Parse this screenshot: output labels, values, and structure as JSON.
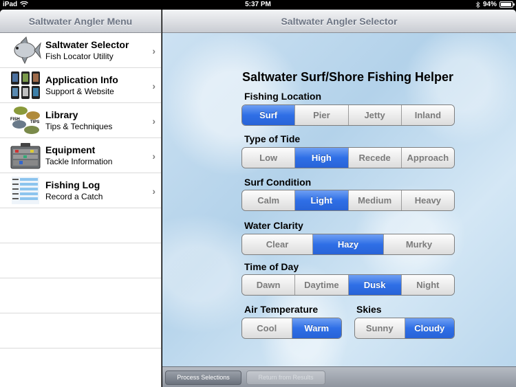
{
  "status": {
    "device": "iPad",
    "time": "5:37 PM",
    "battery": "94%",
    "battery_level": 0.94
  },
  "sidebar": {
    "title": "Saltwater Angler Menu",
    "items": [
      {
        "title": "Saltwater Selector",
        "subtitle": "Fish Locator Utility",
        "icon": "fish-icon"
      },
      {
        "title": "Application Info",
        "subtitle": "Support & Website",
        "icon": "phones-icon"
      },
      {
        "title": "Library",
        "subtitle": "Tips & Techniques",
        "icon": "fish-library-icon",
        "thumb_text": [
          "FISH",
          "TIPS"
        ]
      },
      {
        "title": "Equipment",
        "subtitle": "Tackle Information",
        "icon": "tackle-box-icon"
      },
      {
        "title": "Fishing Log",
        "subtitle": "Record a Catch",
        "icon": "log-list-icon"
      }
    ]
  },
  "main": {
    "title": "Saltwater Angler Selector",
    "helper_title": "Saltwater Surf/Shore Fishing Helper",
    "groups": {
      "location": {
        "label": "Fishing Location",
        "options": [
          "Surf",
          "Pier",
          "Jetty",
          "Inland"
        ],
        "selected": 0
      },
      "tide": {
        "label": "Type of Tide",
        "options": [
          "Low",
          "High",
          "Recede",
          "Approach"
        ],
        "selected": 1
      },
      "surf": {
        "label": "Surf Condition",
        "options": [
          "Calm",
          "Light",
          "Medium",
          "Heavy"
        ],
        "selected": 1
      },
      "clarity": {
        "label": "Water Clarity",
        "options": [
          "Clear",
          "Hazy",
          "Murky"
        ],
        "selected": 1
      },
      "time": {
        "label": "Time of Day",
        "options": [
          "Dawn",
          "Daytime",
          "Dusk",
          "Night"
        ],
        "selected": 2
      },
      "air": {
        "label": "Air Temperature",
        "options": [
          "Cool",
          "Warm"
        ],
        "selected": 1
      },
      "skies": {
        "label": "Skies",
        "options": [
          "Sunny",
          "Cloudy"
        ],
        "selected": 1
      }
    }
  },
  "toolbar": {
    "process": "Process Selections",
    "return": "Return from Results"
  },
  "colors": {
    "selected": "#2f6fe6",
    "nav_text": "#6d7584"
  }
}
